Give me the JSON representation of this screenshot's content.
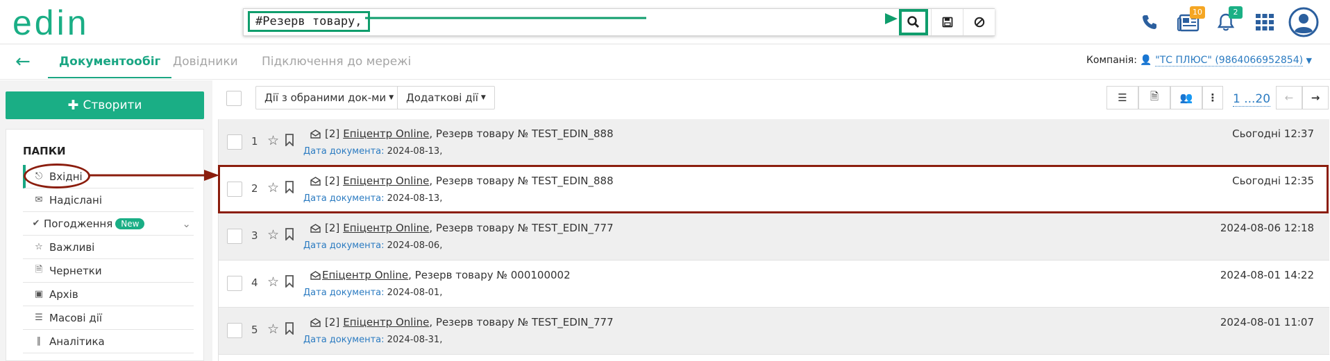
{
  "header": {
    "logo_text": "edin",
    "search_value": "#Резерв товару,",
    "icons": [
      "phone-icon",
      "newspaper-icon",
      "bell-icon",
      "apps-grid-icon",
      "user-avatar-icon"
    ],
    "news_badge": "10",
    "notif_badge": "2"
  },
  "subnav": {
    "tabs": [
      "Документообіг",
      "Довідники",
      "Підключення до мережі"
    ],
    "company_label": "Компанія:",
    "company_value": "\"ТС ПЛЮС\" (9864066952854)"
  },
  "sidebar": {
    "create_label": "Створити",
    "folders_title": "ПАПКИ",
    "items": [
      {
        "label": "Вхідні",
        "icon": "inbox-icon"
      },
      {
        "label": "Надіслані",
        "icon": "envelope-icon"
      },
      {
        "label": "Погодження",
        "icon": "check-icon",
        "badge": "New"
      },
      {
        "label": "Важливі",
        "icon": "star-icon"
      },
      {
        "label": "Чернетки",
        "icon": "file-icon"
      },
      {
        "label": "Архів",
        "icon": "archive-icon"
      },
      {
        "label": "Масові дії",
        "icon": "bulk-icon"
      },
      {
        "label": "Аналітика",
        "icon": "chart-icon"
      }
    ]
  },
  "toolbar": {
    "bulk_actions": "Дії з обраними док-ми",
    "extra_actions": "Додаткові дії",
    "pager": "1 ...20"
  },
  "documents": {
    "meta_label": "Дата документа:",
    "rows": [
      {
        "num": "1",
        "prefix": "[2]",
        "sender": "Епіцентр Online",
        "rest": ", Резерв товару № TEST_EDIN_888",
        "doc_date": "2024-08-13,",
        "time": "Сьогодні 12:37"
      },
      {
        "num": "2",
        "prefix": "[2]",
        "sender": "Епіцентр Online",
        "rest": ", Резерв товару № TEST_EDIN_888",
        "doc_date": "2024-08-13,",
        "time": "Сьогодні 12:35"
      },
      {
        "num": "3",
        "prefix": "[2]",
        "sender": "Епіцентр Online",
        "rest": ", Резерв товару № TEST_EDIN_777",
        "doc_date": "2024-08-06,",
        "time": "2024-08-06 12:18"
      },
      {
        "num": "4",
        "prefix": "",
        "sender": "Епіцентр Online",
        "rest": ", Резерв товару № 000100002",
        "doc_date": "2024-08-01,",
        "time": "2024-08-01 14:22"
      },
      {
        "num": "5",
        "prefix": "[2]",
        "sender": "Епіцентр Online",
        "rest": ", Резерв товару № TEST_EDIN_777",
        "doc_date": "2024-08-31,",
        "time": "2024-08-01 11:07"
      }
    ]
  },
  "colors": {
    "accent": "#1aae85",
    "highlight": "#8b1d0d",
    "link": "#2b7bc1"
  }
}
